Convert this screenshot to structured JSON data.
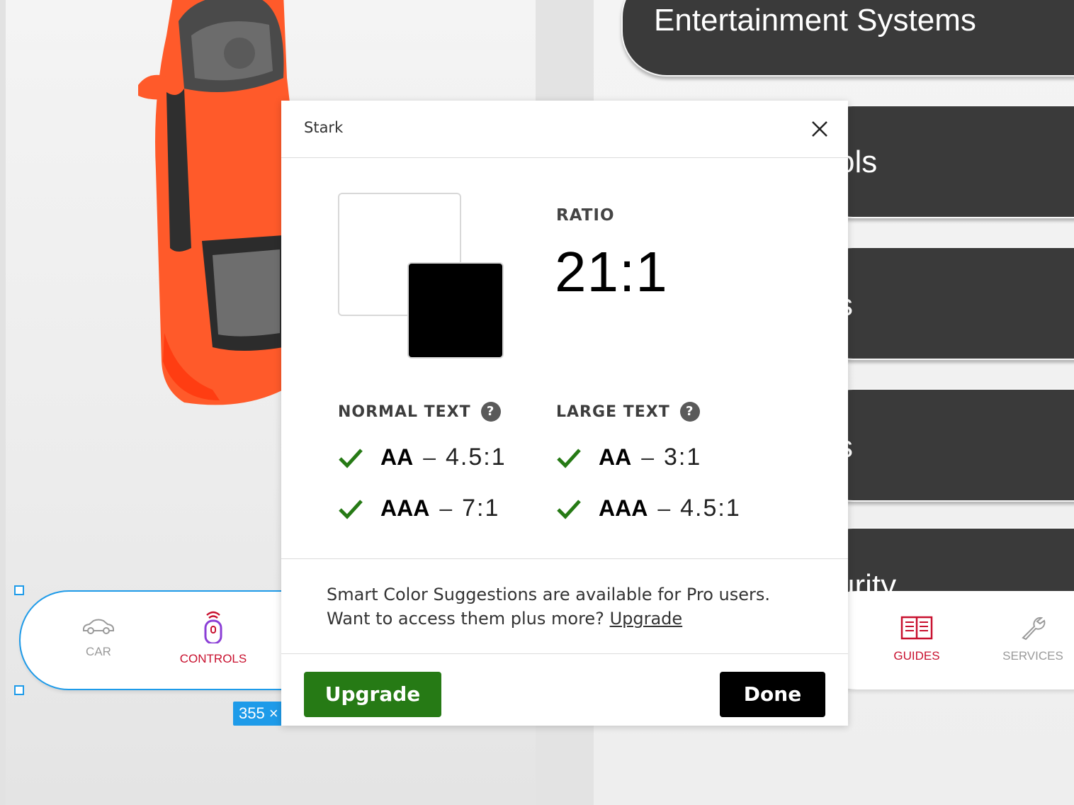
{
  "background": {
    "menu_items": [
      {
        "label": "Entertainment Systems"
      },
      {
        "label": "ols"
      },
      {
        "label": "s"
      },
      {
        "label": "s"
      },
      {
        "label": "urity"
      }
    ],
    "left_tabbar": {
      "tabs": [
        {
          "label": "CAR",
          "icon": "car-icon"
        },
        {
          "label": "CONTROLS",
          "icon": "remote-icon"
        }
      ],
      "dimension_badge": "355 ×"
    },
    "right_tabbar": {
      "tabs": [
        {
          "label": "GUIDES",
          "icon": "book-icon"
        },
        {
          "label": "SERVICES",
          "icon": "wrench-icon"
        }
      ]
    },
    "colors": {
      "accent_red": "#c8102e",
      "car_orange": "#ff5522",
      "selection_blue": "#1e9be9"
    }
  },
  "dialog": {
    "title": "Stark",
    "ratio_label": "RATIO",
    "ratio_value": "21:1",
    "foreground_color": "#ffffff",
    "background_color": "#000000",
    "normal_text": {
      "label": "NORMAL TEXT",
      "checks": [
        {
          "level": "AA",
          "dash": "–",
          "requirement": "4.5:1",
          "passed": true
        },
        {
          "level": "AAA",
          "dash": "–",
          "requirement": "7:1",
          "passed": true
        }
      ]
    },
    "large_text": {
      "label": "LARGE TEXT",
      "checks": [
        {
          "level": "AA",
          "dash": "–",
          "requirement": "3:1",
          "passed": true
        },
        {
          "level": "AAA",
          "dash": "–",
          "requirement": "4.5:1",
          "passed": true
        }
      ]
    },
    "promo": {
      "line1": "Smart Color Suggestions are available for Pro users.",
      "line2": "Want to access them plus more?",
      "link": "Upgrade"
    },
    "buttons": {
      "upgrade": "Upgrade",
      "done": "Done"
    },
    "colors": {
      "pass_green": "#267a15"
    }
  }
}
